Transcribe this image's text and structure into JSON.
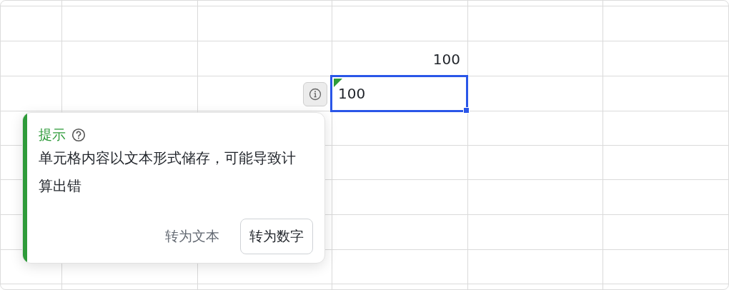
{
  "sheet": {
    "cells": [
      {
        "text": "100",
        "kind": "number",
        "selected": false,
        "text_stored": false
      },
      {
        "text": "100",
        "kind": "text",
        "selected": true,
        "text_stored": true
      }
    ]
  },
  "popover": {
    "title": "提示",
    "message": "单元格内容以文本形式储存，可能导致计算出错",
    "buttons": [
      {
        "label": "转为文本",
        "kind": "text"
      },
      {
        "label": "转为数字",
        "kind": "outlined"
      }
    ]
  }
}
